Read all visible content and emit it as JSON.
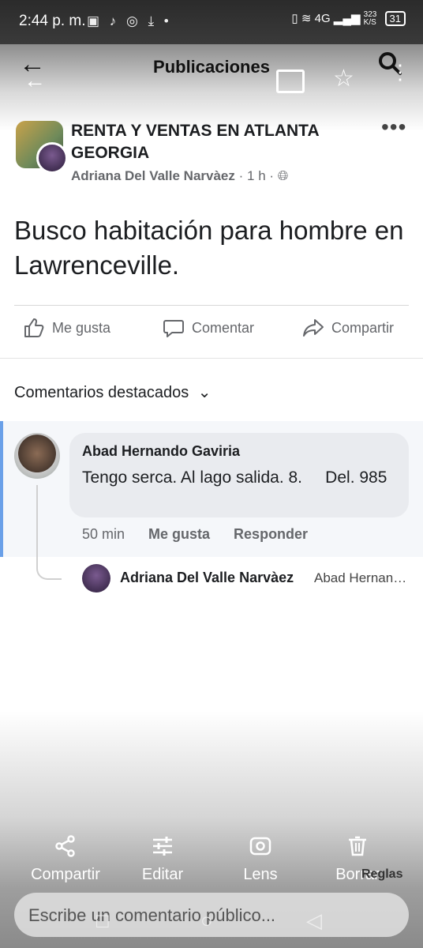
{
  "status_bar": {
    "time": "2:44 p. m.",
    "network": "4G",
    "speed": "323\nK/S",
    "battery": "31"
  },
  "header": {
    "title": "Publicaciones"
  },
  "post": {
    "group_name": "RENTA Y VENTAS EN ATLANTA GEORGIA",
    "author": "Adriana Del Valle Narvàez",
    "time": "1 h",
    "text": "Busco habitación para hombre en Lawrenceville.",
    "actions": {
      "like": "Me gusta",
      "comment": "Comentar",
      "share": "Compartir"
    }
  },
  "comments": {
    "sort_label": "Comentarios destacados",
    "items": [
      {
        "author": "Abad Hernando Gaviria",
        "text": "Tengo serca. Al lago salida. 8.     Del. 985",
        "time": "50 min",
        "like": "Me gusta",
        "reply": "Responder"
      }
    ],
    "reply": {
      "author": "Adriana Del Valle Narvàez",
      "preview": "Abad Hernando Gaviria"
    }
  },
  "share_sheet": {
    "share": "Compartir",
    "edit": "Editar",
    "lens": "Lens",
    "delete": "Borrar",
    "rules": "Reglas"
  },
  "composer": {
    "placeholder": "Escribe un comentario público..."
  },
  "icons": [
    "back-icon",
    "search-icon",
    "cast-icon",
    "star-icon",
    "globe-icon",
    "like-icon",
    "comment-icon",
    "share-icon",
    "chevron-down-icon",
    "edit-icon",
    "lens-icon",
    "trash-icon"
  ]
}
